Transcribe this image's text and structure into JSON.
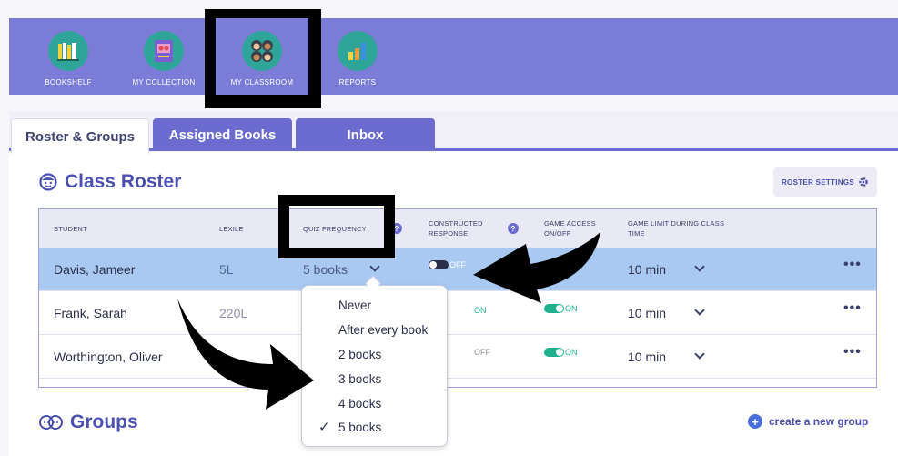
{
  "nav": {
    "items": [
      {
        "label": "BOOKSHELF",
        "icon": "bookshelf-icon"
      },
      {
        "label": "MY COLLECTION",
        "icon": "collection-icon"
      },
      {
        "label": "MY CLASSROOM",
        "icon": "classroom-icon"
      },
      {
        "label": "REPORTS",
        "icon": "reports-icon"
      }
    ]
  },
  "tabs": [
    {
      "label": "Roster & Groups",
      "active": true
    },
    {
      "label": "Assigned Books",
      "active": false
    },
    {
      "label": "Inbox",
      "active": false
    }
  ],
  "roster": {
    "title": "Class Roster",
    "settings_label": "ROSTER SETTINGS"
  },
  "table": {
    "headers": {
      "student": "STUDENT",
      "lexile": "LEXILE",
      "quiz_frequency": "QUIZ FREQUENCY",
      "constructed_response_1": "CONSTRUCTED",
      "constructed_response_2": "RESPONSE",
      "game_access_1": "GAME ACCESS",
      "game_access_2": "ON/OFF",
      "game_limit_1": "GAME LIMIT DURING CLASS",
      "game_limit_2": "TIME"
    },
    "help_glyph": "?",
    "rows": [
      {
        "student": "Davis, Jameer",
        "lexile": "5L",
        "quiz": "5 books",
        "constructed": "OFF",
        "game_access": "",
        "game_limit": "10 min",
        "more": "•••"
      },
      {
        "student": "Frank, Sarah",
        "lexile": "220L",
        "quiz": "",
        "constructed": "ON",
        "game_access": "ON",
        "game_limit": "10 min",
        "more": "•••"
      },
      {
        "student": "Worthington, Oliver",
        "lexile": "",
        "quiz": "",
        "constructed": "OFF",
        "game_access": "ON",
        "game_limit": "10 min",
        "more": "•••"
      }
    ]
  },
  "dropdown": {
    "options": [
      "Never",
      "After every book",
      "2 books",
      "3 books",
      "4 books",
      "5 books"
    ],
    "selected": "5 books",
    "check": "✓"
  },
  "groups": {
    "title": "Groups",
    "create_label": "create a new group",
    "plus": "+"
  },
  "colors": {
    "nav_bg": "#7b7bd8",
    "accent": "#6b6bd0",
    "toggle_on": "#1fb08f",
    "toggle_off": "#2b2f4a",
    "selected_row": "#a9c9f2"
  }
}
